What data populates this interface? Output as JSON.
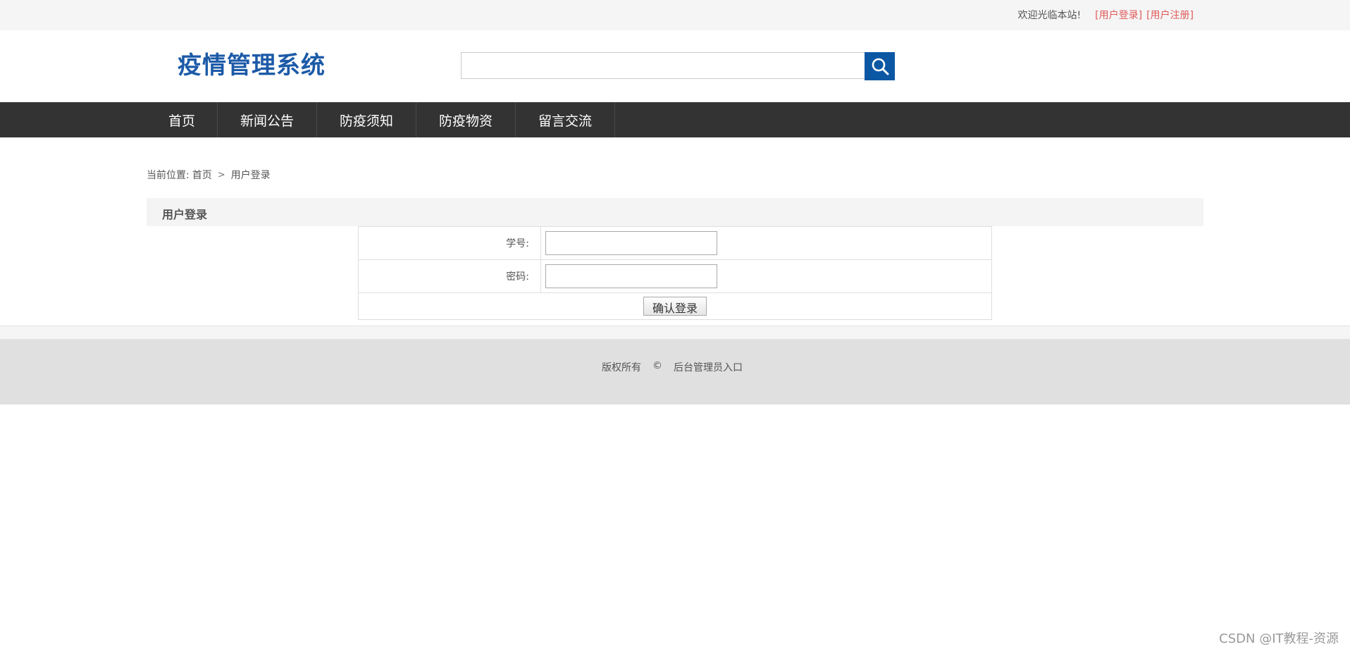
{
  "topbar": {
    "welcome": "欢迎光临本站!",
    "login_link": "[用户登录]",
    "register_link": "[用户注册]"
  },
  "header": {
    "logo": "疫情管理系统",
    "search": {
      "value": "",
      "placeholder": ""
    },
    "search_icon": "search-icon"
  },
  "nav": {
    "items": [
      {
        "label": "首页"
      },
      {
        "label": "新闻公告"
      },
      {
        "label": "防疫须知"
      },
      {
        "label": "防疫物资"
      },
      {
        "label": "留言交流"
      }
    ]
  },
  "breadcrumb": {
    "prefix": "当前位置:",
    "home": "首页",
    "separator": ">",
    "current": "用户登录"
  },
  "panel": {
    "title": "用户登录",
    "student_id_label": "学号:",
    "student_id_value": "",
    "password_label": "密码:",
    "password_value": "",
    "submit_label": "确认登录"
  },
  "footer": {
    "copyright": "版权所有",
    "copy_symbol": "©",
    "admin_link": "后台管理员入口"
  },
  "watermark": "CSDN @IT教程-资源",
  "colors": {
    "brand_blue": "#1c5aa8",
    "search_button": "#0b57a4",
    "nav_bg": "#333333",
    "link_red": "#e05a5a"
  }
}
